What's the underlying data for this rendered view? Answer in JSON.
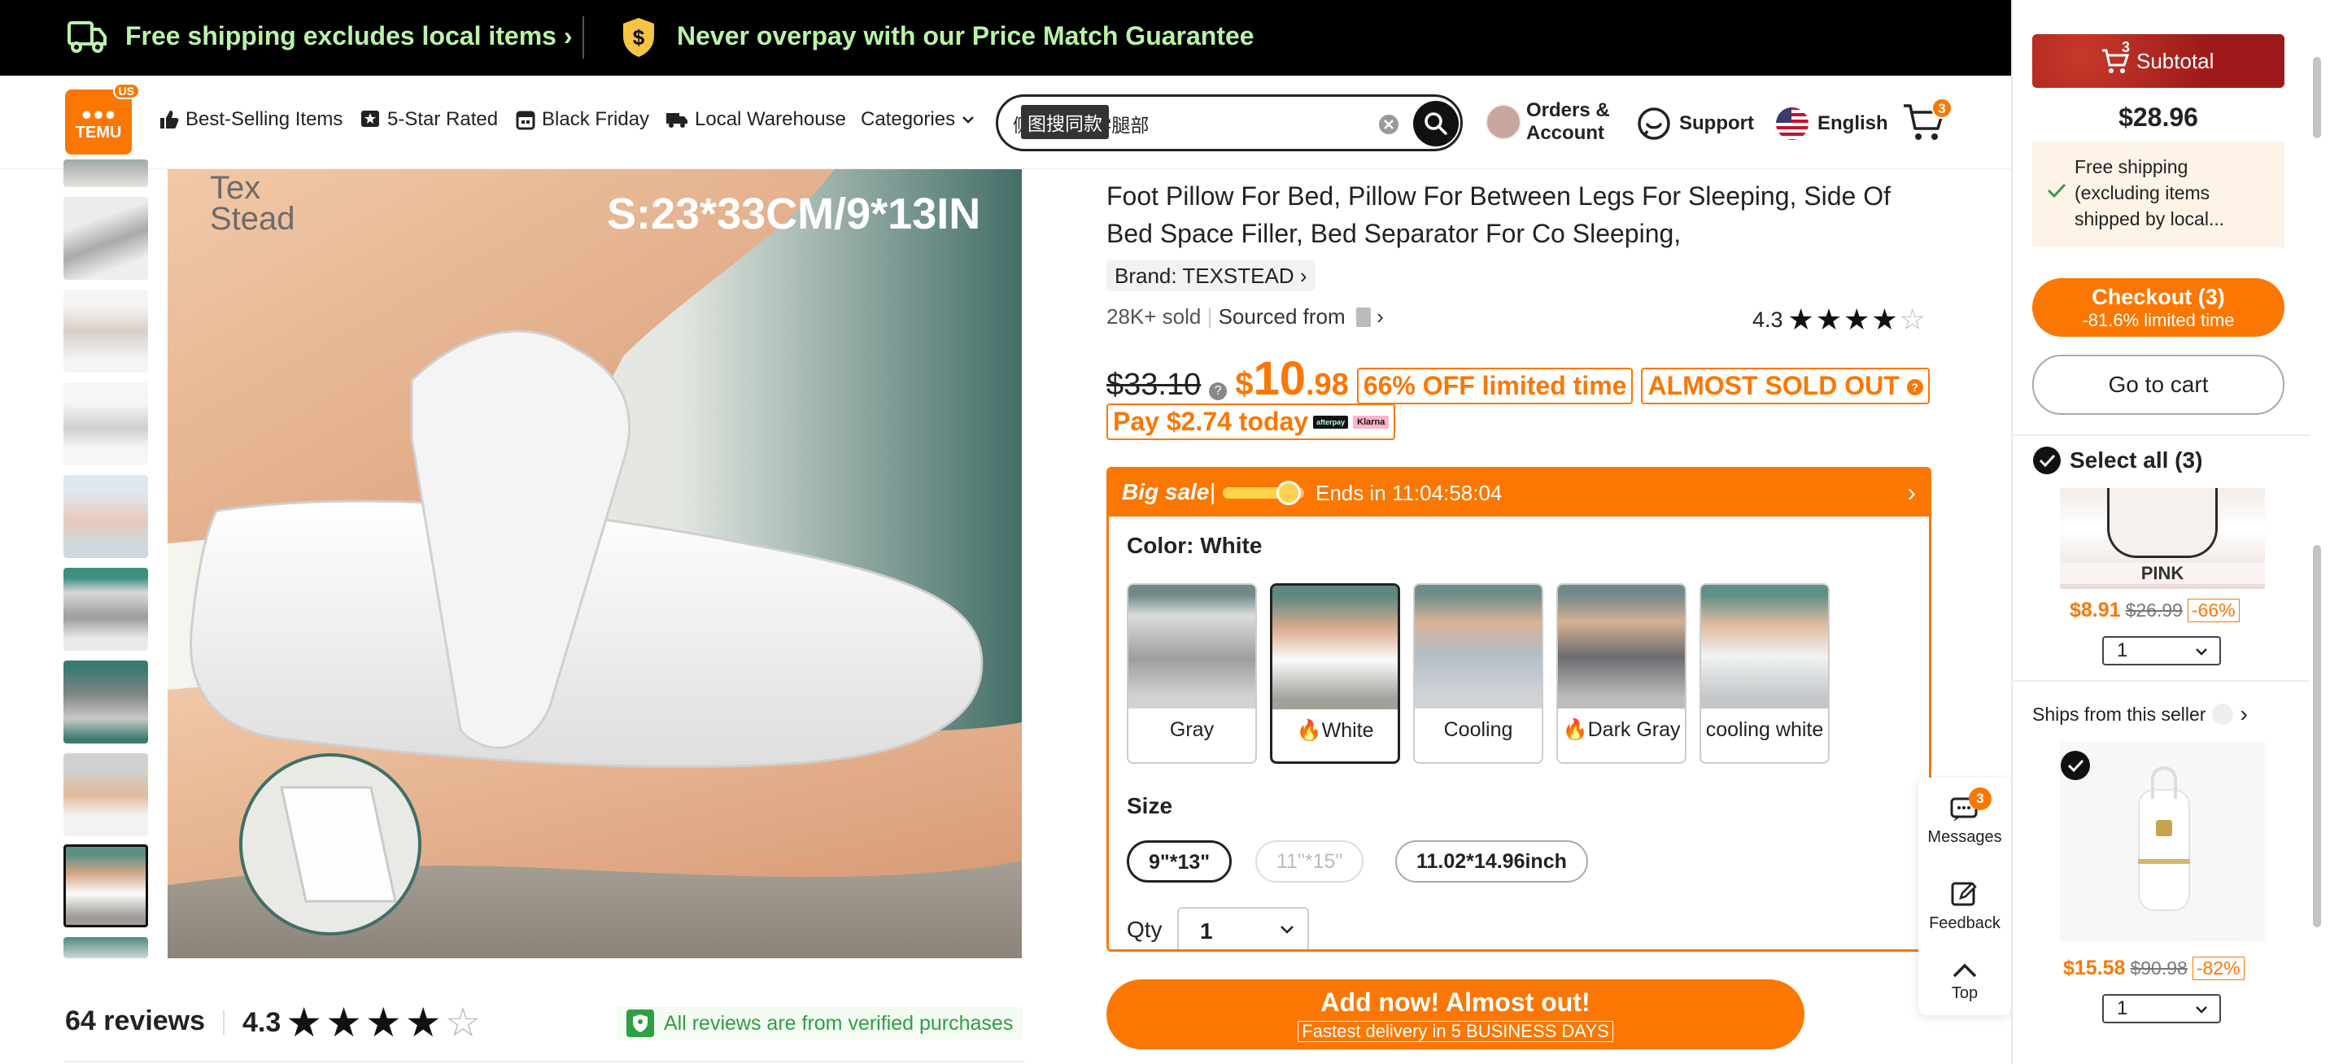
{
  "banner": {
    "shipping": "Free shipping excludes local items",
    "price_match": "Never overpay with our Price Match Guarantee"
  },
  "nav": {
    "logo_text": "TEMU",
    "logo_region": "US",
    "items": [
      "Best-Selling Items",
      "5-Star Rated",
      "Black Friday",
      "Local Warehouse",
      "Categories"
    ],
    "search_value": "侧 人体工学腿部",
    "search_image_tooltip": "图搜同款",
    "orders": "Orders &",
    "account": "Account",
    "support": "Support",
    "language": "English",
    "cart_count": "3"
  },
  "product": {
    "title_lines": [
      "Foot Pillow For Bed, Pillow For Between Legs For Sleeping, Side Of",
      "Bed Space Filler, Bed Separator For Co Sleeping,"
    ],
    "brand": "Brand: TEXSTEAD",
    "sold": "28K+ sold",
    "sourced_from": "Sourced from",
    "rating": "4.3",
    "rating_stars": 4.3,
    "old_price": "$33.10",
    "price_currency": "$",
    "price_int": "10",
    "price_dec": ".98",
    "discount": "66% OFF limited time",
    "almost_sold_out": "ALMOST SOLD OUT",
    "pay_today": "Pay $2.74 today",
    "pay_badge_1": "afterpay",
    "pay_badge_2": "Klarna",
    "image_text": "S:23*33CM/9*13IN",
    "image_brand": "Tex Stead"
  },
  "sale": {
    "label": "Big sale",
    "ends": "Ends in 11:04:58:04",
    "color_label": "Color: White",
    "colors": [
      "Gray",
      "White",
      "Cooling",
      "Dark Gray",
      "cooling white"
    ],
    "size_label": "Size",
    "sizes": [
      "9\"*13\"",
      "11\"*15\"",
      "11.02*14.96inch"
    ],
    "qty_label": "Qty",
    "qty_value": "1"
  },
  "add_button": {
    "main": "Add now! Almost out!",
    "sub": "Fastest delivery in 5 BUSINESS DAYS"
  },
  "reviews": {
    "count": "64 reviews",
    "rating": "4.3",
    "verified": "All reviews are from verified purchases"
  },
  "float": {
    "messages": "Messages",
    "messages_count": "3",
    "feedback": "Feedback",
    "top": "Top"
  },
  "cart": {
    "subtotal_count": "3",
    "subtotal_label": "Subtotal",
    "total": "$28.96",
    "free_ship_lines": [
      "Free shipping",
      "(excluding items",
      "shipped by local..."
    ],
    "checkout": "Checkout (3)",
    "checkout_sub": "-81.6% limited time",
    "goto_cart": "Go to cart",
    "select_all": "Select all (3)",
    "items": [
      {
        "variant": "PINK",
        "price": "$8.91",
        "old": "$26.99",
        "off": "-66%",
        "qty": "1"
      },
      {
        "variant": "",
        "price": "$15.58",
        "old": "$90.98",
        "off": "-82%",
        "qty": "1"
      }
    ],
    "ships_from": "Ships from this seller"
  },
  "colors": {
    "accent": "#fb7701",
    "banner_green": "#b9f3a8",
    "subtotal_red": "#9e1a1a"
  }
}
